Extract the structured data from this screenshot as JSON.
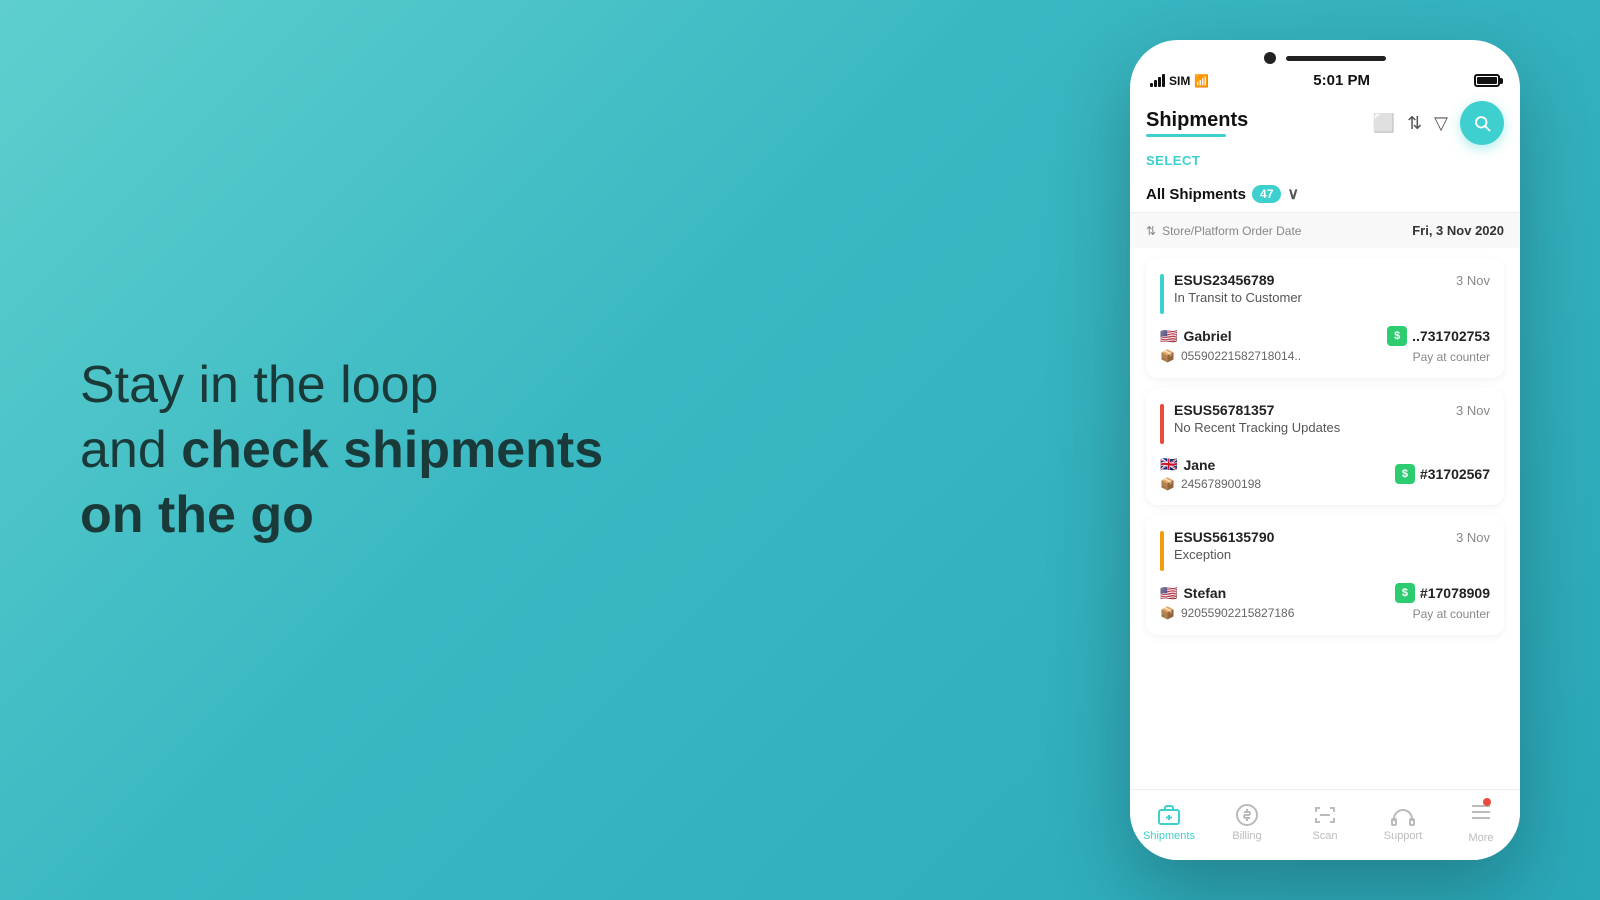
{
  "hero": {
    "line1": "Stay in the loop",
    "line2": "and ",
    "line2_bold": "check shipments",
    "line3_bold": "on the go"
  },
  "phone": {
    "status_bar": {
      "carrier": "SIM",
      "time": "5:01 PM"
    },
    "header": {
      "title": "Shipments",
      "select_label": "SELECT"
    },
    "filter": {
      "label": "All Shipments",
      "count": "47"
    },
    "sort_header": {
      "label": "Store/Platform Order Date",
      "date": "Fri, 3 Nov 2020"
    },
    "shipments": [
      {
        "tracking_id": "ESUS23456789",
        "date": "3 Nov",
        "status": "In Transit to Customer",
        "status_color": "#3ecfcf",
        "customer_flag": "🇺🇸",
        "customer_name": "Gabriel",
        "courier_icon": "📦",
        "courier_tracking": "05590221582718014..",
        "order_icon_color": "#2ecc71",
        "order_id": "..731702753",
        "payment": "Pay at counter"
      },
      {
        "tracking_id": "ESUS56781357",
        "date": "3 Nov",
        "status": "No Recent Tracking Updates",
        "status_color": "#e74c3c",
        "customer_flag": "🇬🇧",
        "customer_name": "Jane",
        "courier_icon": "📦",
        "courier_tracking": "245678900198",
        "order_icon_color": "#2ecc71",
        "order_id": "#31702567",
        "payment": null
      },
      {
        "tracking_id": "ESUS56135790",
        "date": "3 Nov",
        "status": "Exception",
        "status_color": "#f39c12",
        "customer_flag": "🇺🇸",
        "customer_name": "Stefan",
        "courier_icon": "📦",
        "courier_tracking": "92055902215827186",
        "order_icon_color": "#2ecc71",
        "order_id": "#17078909",
        "payment": "Pay at counter"
      }
    ],
    "bottom_nav": [
      {
        "icon": "📦",
        "label": "Shipments",
        "active": true
      },
      {
        "icon": "💵",
        "label": "Billing",
        "active": false
      },
      {
        "icon": "📷",
        "label": "Scan",
        "active": false
      },
      {
        "icon": "🎧",
        "label": "Support",
        "active": false
      },
      {
        "icon": "≡",
        "label": "More",
        "active": false,
        "has_dot": true
      }
    ]
  }
}
